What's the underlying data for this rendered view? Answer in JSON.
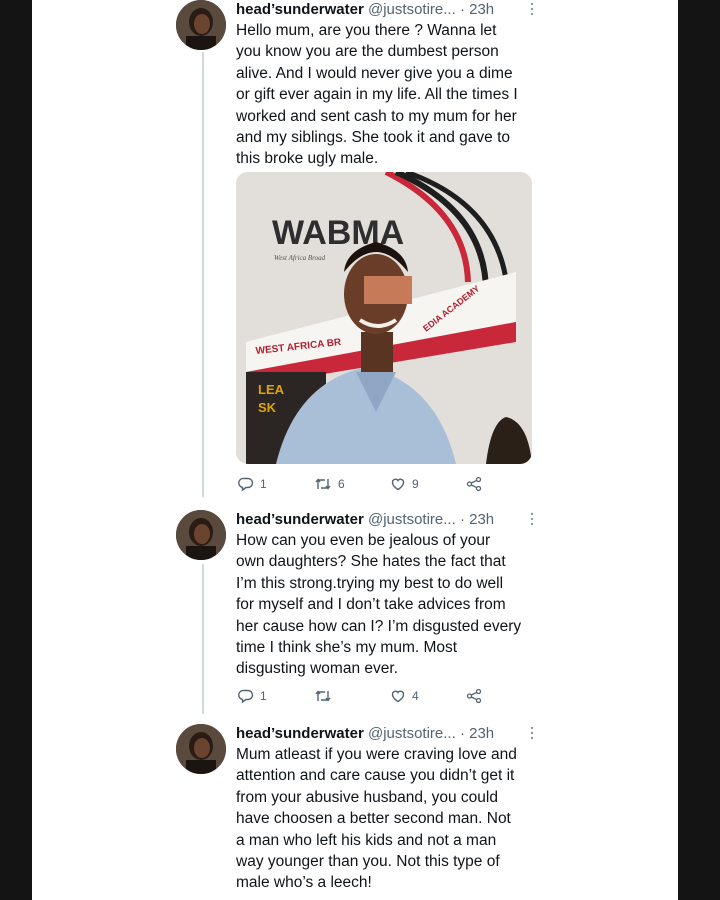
{
  "tweets": [
    {
      "name": "head’sunderwater",
      "handle": "@justsotire...",
      "separator": "·",
      "time": "23h",
      "text": "Hello mum, are you there ? Wanna let\nyou know you are the dumbest person\nalive. And I would never give you a dime\nor gift ever again in my life. All the times I\nworked and sent cash to my mum for her\nand my siblings. She took it and gave to\nthis broke ugly male.",
      "media": {
        "logo_text": "WABMA",
        "logo_sub": "West Africa Broad",
        "banner_left": "WEST AFRICA BR",
        "banner_right": "EDIA ACADEMY",
        "panel_line1": "LEA",
        "panel_line2": "SK"
      },
      "replies": "1",
      "retweets": "6",
      "likes": "9"
    },
    {
      "name": "head’sunderwater",
      "handle": "@justsotire...",
      "separator": "·",
      "time": "23h",
      "text": "How can you even be jealous of your\nown daughters? She hates the fact that\nI’m this strong.trying my best to do well\nfor myself and I don’t take advices from\nher cause how can I? I’m disgusted every\ntime I think she’s my mum. Most\ndisgusting woman ever.",
      "replies": "1",
      "retweets": "",
      "likes": "4"
    },
    {
      "name": "head’sunderwater",
      "handle": "@justsotire...",
      "separator": "·",
      "time": "23h",
      "text": "Mum atleast if you were craving love and\nattention and care cause you didn’t get it\nfrom your abusive husband, you could\nhave choosen  a better second man. Not\na man who left his kids and not a man\nway younger than you. Not this type  of\nmale who’s a leech!"
    }
  ],
  "colors": {
    "text": "#0f1419",
    "secondary": "#536471",
    "thread_line": "#cfd9de",
    "brand_red": "#c8283a"
  },
  "icons": [
    "reply-icon",
    "retweet-icon",
    "like-icon",
    "share-icon",
    "more-icon"
  ]
}
